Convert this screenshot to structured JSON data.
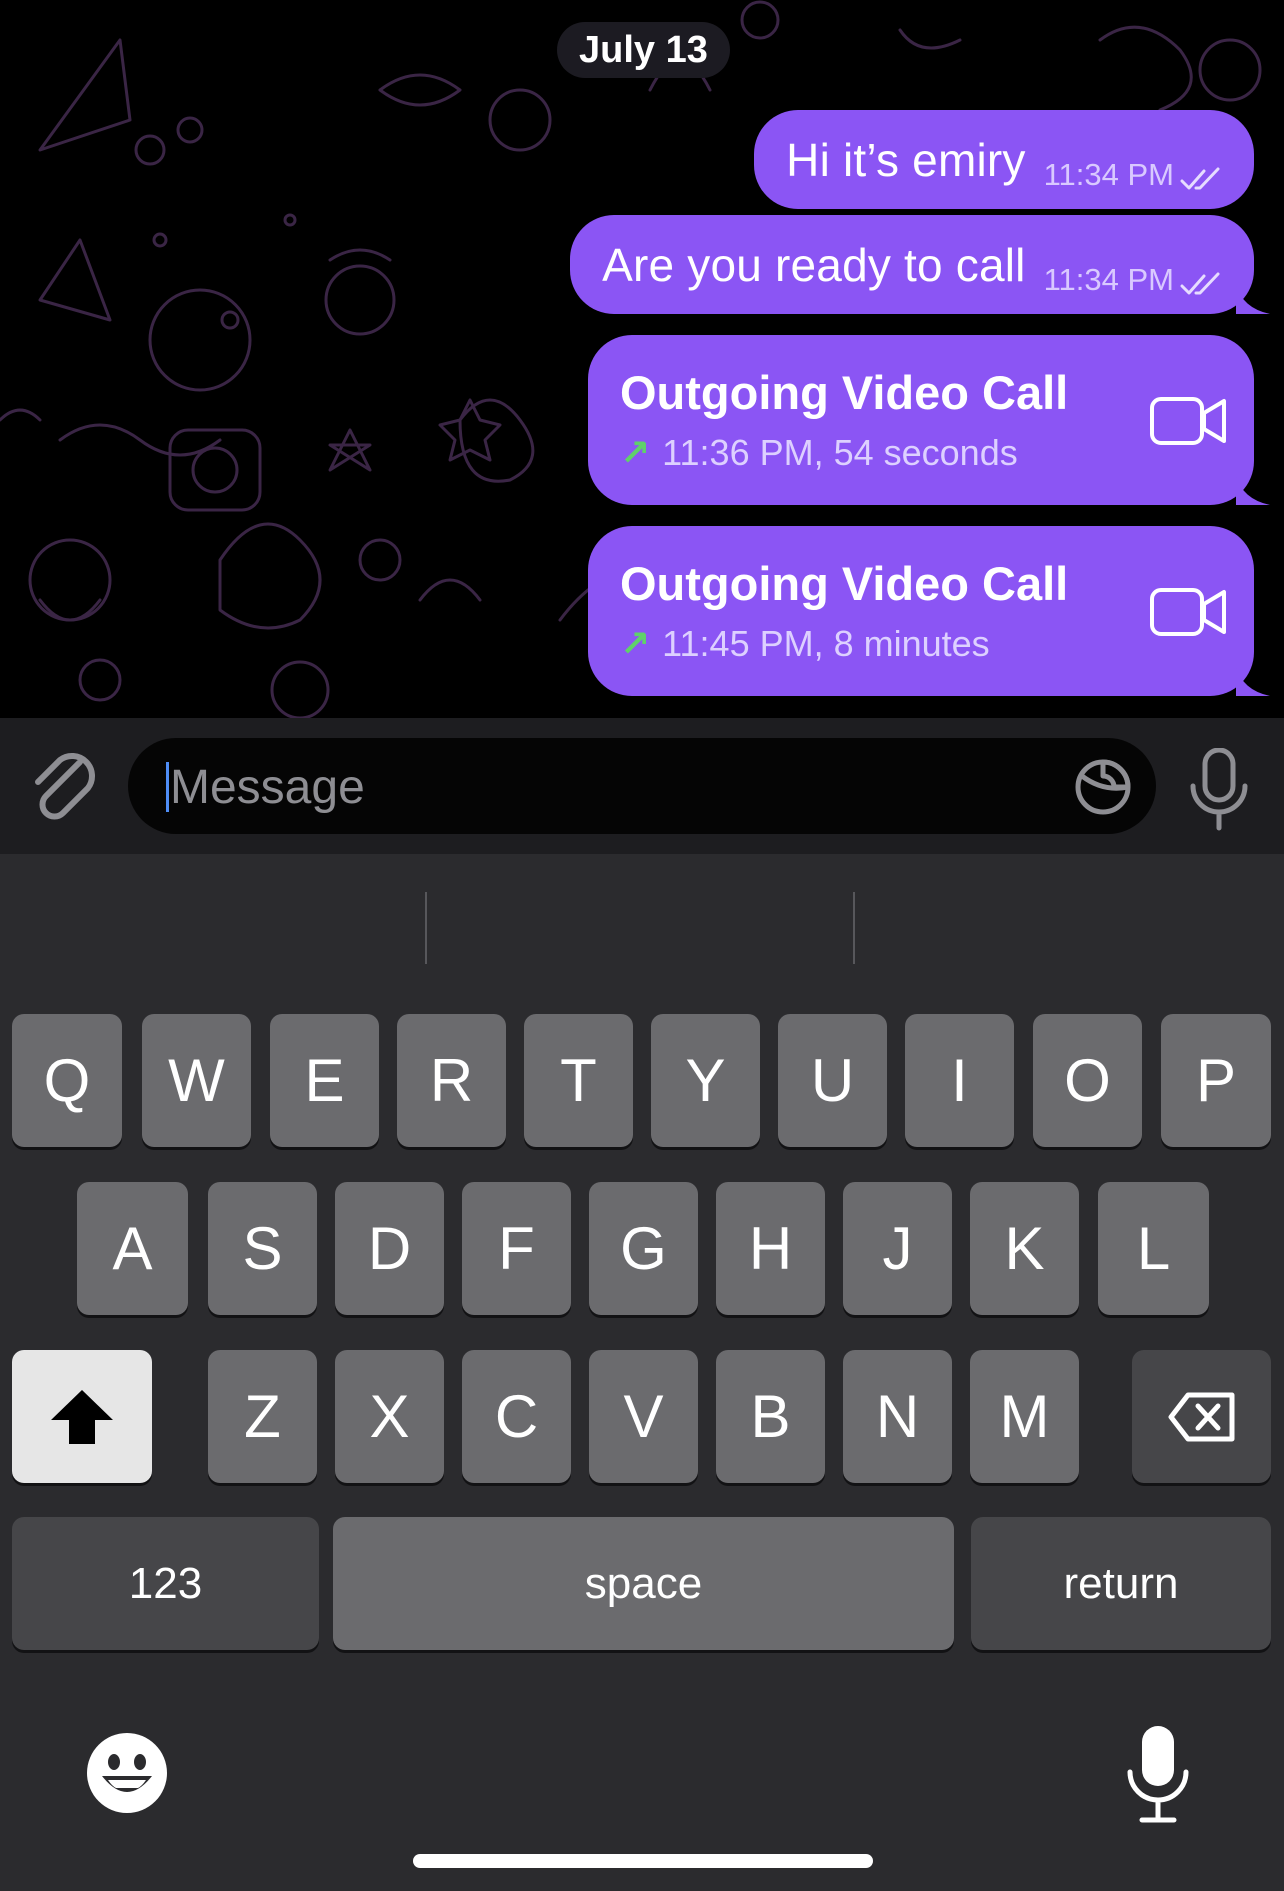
{
  "chat": {
    "date_label": "July 13",
    "colors": {
      "bubble": "#8b55f4",
      "background": "#000000",
      "call_arrow": "#5fd16a"
    },
    "messages": [
      {
        "text": "Hi it’s emiry",
        "time": "11:34 PM",
        "status_icon": "double-check-icon"
      },
      {
        "text": "Are you ready to call",
        "time": "11:34 PM",
        "status_icon": "double-check-icon"
      }
    ],
    "calls": [
      {
        "title": "Outgoing Video Call",
        "detail": "11:36 PM, 54 seconds",
        "icon": "video-camera-icon"
      },
      {
        "title": "Outgoing Video Call",
        "detail": "11:45 PM, 8 minutes",
        "icon": "video-camera-icon"
      }
    ]
  },
  "input": {
    "placeholder": "Message",
    "value": "",
    "icons": [
      "paperclip-icon",
      "sticker-icon",
      "microphone-icon"
    ]
  },
  "keyboard": {
    "row1": [
      "Q",
      "W",
      "E",
      "R",
      "T",
      "Y",
      "U",
      "I",
      "O",
      "P"
    ],
    "row2": [
      "A",
      "S",
      "D",
      "F",
      "G",
      "H",
      "J",
      "K",
      "L"
    ],
    "row3": [
      "Z",
      "X",
      "C",
      "V",
      "B",
      "N",
      "M"
    ],
    "numbers_label": "123",
    "space_label": "space",
    "return_label": "return",
    "icons": [
      "shift-icon",
      "backspace-icon",
      "emoji-icon",
      "dictation-mic-icon"
    ]
  }
}
